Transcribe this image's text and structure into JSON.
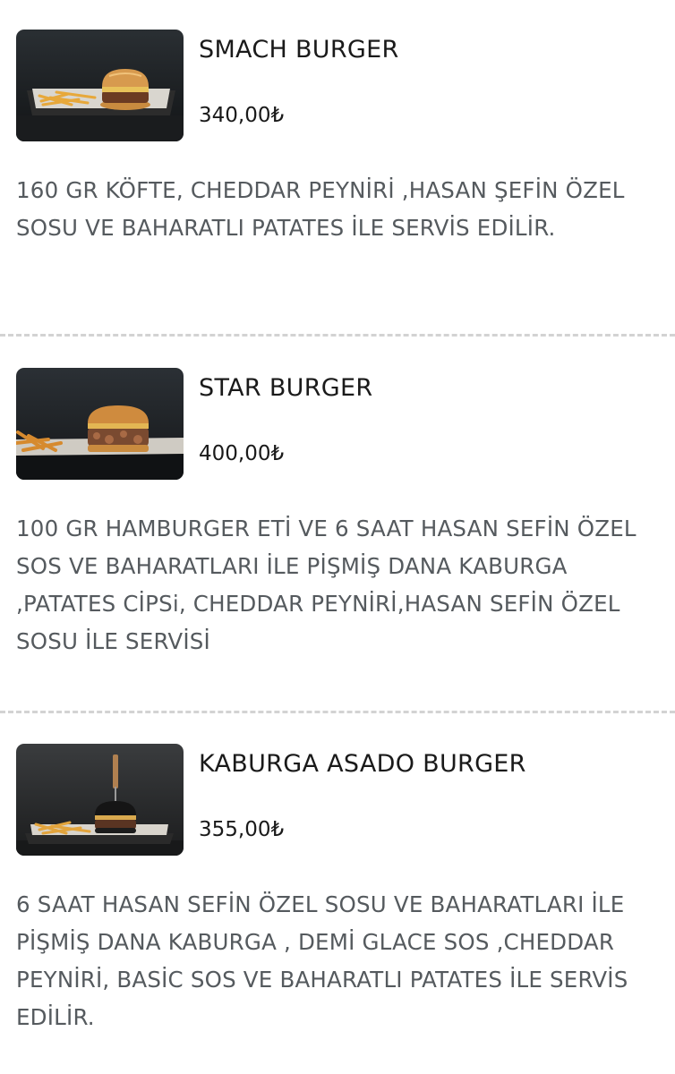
{
  "items": [
    {
      "name": "SMACH BURGER",
      "price": "340,00₺",
      "description": "160 GR KÖFTE, CHEDDAR PEYNİRİ ,HASAN ŞEFİN ÖZEL SOSU VE BAHARATLI PATATES İLE SERVİS EDİLİR."
    },
    {
      "name": "STAR BURGER",
      "price": "400,00₺",
      "description": "100 GR HAMBURGER ETİ VE 6 SAAT HASAN SEFİN ÖZEL SOS VE BAHARATLARI İLE PİŞMİŞ DANA KABURGA ,PATATES CİPSi, CHEDDAR PEYNİRİ,HASAN SEFİN ÖZEL SOSU İLE SERVİSİ"
    },
    {
      "name": "KABURGA ASADO BURGER",
      "price": "355,00₺",
      "description": "6 SAAT HASAN SEFİN ÖZEL SOSU VE BAHARATLARI İLE PİŞMİŞ DANA KABURGA , DEMİ GLACE SOS ,CHEDDAR PEYNİRİ, BASİC SOS VE BAHARATLI PATATES İLE SERVİS EDİLİR."
    }
  ]
}
